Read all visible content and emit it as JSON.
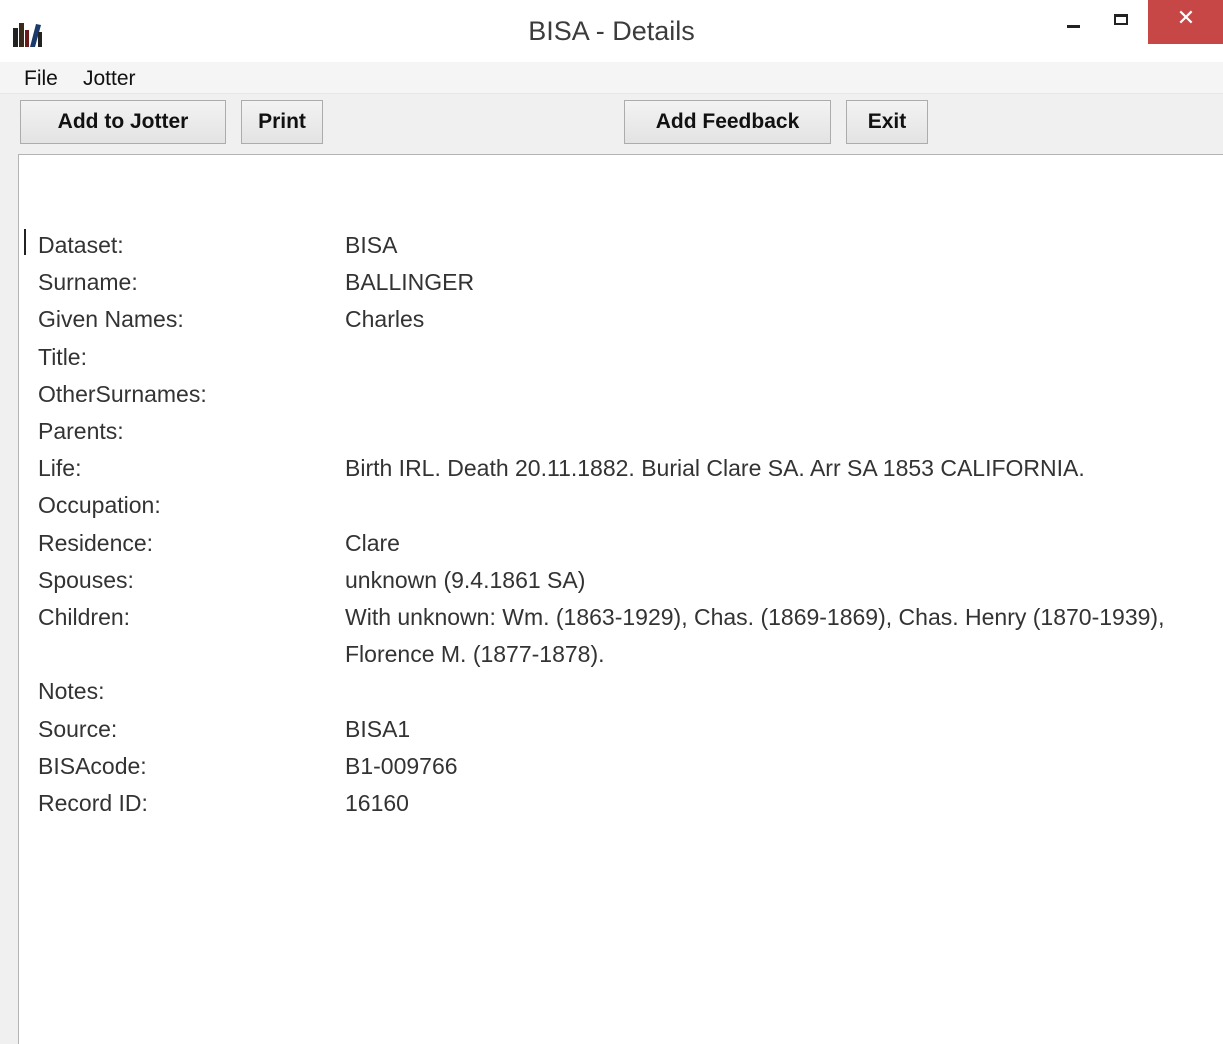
{
  "window": {
    "title": "BISA - Details",
    "close_glyph": "✕"
  },
  "menu": {
    "items": [
      "File",
      "Jotter"
    ]
  },
  "toolbar": {
    "add_to_jotter": "Add to Jotter",
    "print": "Print",
    "add_feedback": "Add Feedback",
    "exit": "Exit"
  },
  "record": {
    "fields": [
      {
        "label": "Dataset:",
        "value": "BISA"
      },
      {
        "label": "Surname:",
        "value": "BALLINGER"
      },
      {
        "label": "Given Names:",
        "value": "Charles"
      },
      {
        "label": "Title:",
        "value": ""
      },
      {
        "label": "OtherSurnames:",
        "value": ""
      },
      {
        "label": "Parents:",
        "value": ""
      },
      {
        "label": "Life:",
        "value": "Birth IRL. Death 20.11.1882. Burial Clare SA. Arr SA 1853 CALIFORNIA."
      },
      {
        "label": "Occupation:",
        "value": ""
      },
      {
        "label": "Residence:",
        "value": "Clare"
      },
      {
        "label": "Spouses:",
        "value": "unknown (9.4.1861 SA)"
      },
      {
        "label": "Children:",
        "value": "With unknown: Wm. (1863-1929), Chas. (1869-1869), Chas. Henry (1870-1939), Florence M. (1877-1878)."
      },
      {
        "label": "Notes:",
        "value": ""
      },
      {
        "label": "Source:",
        "value": "BISA1"
      },
      {
        "label": "BISAcode:",
        "value": "B1-009766"
      },
      {
        "label": "Record ID:",
        "value": "16160"
      }
    ]
  },
  "colors": {
    "close_button": "#c74747",
    "window_bg": "#f0f0f0",
    "content_bg": "#ffffff"
  },
  "icons": {
    "app": "books-icon",
    "minimize": "minimize-icon",
    "maximize": "maximize-icon",
    "close": "close-icon"
  }
}
